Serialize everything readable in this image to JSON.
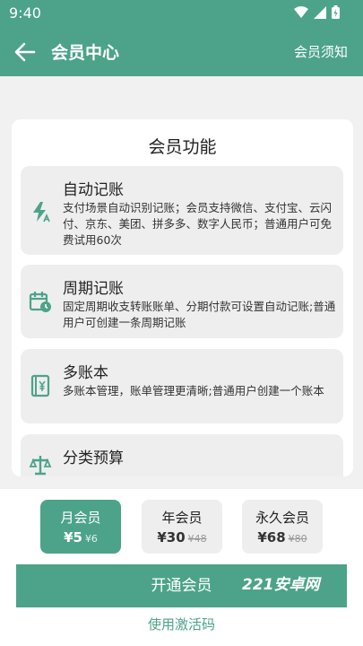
{
  "status": {
    "time": "9:40"
  },
  "appbar": {
    "title": "会员中心",
    "action": "会员须知"
  },
  "features": {
    "title": "会员功能",
    "items": [
      {
        "title": "自动记账",
        "desc": "支付场景自动识别记账；会员支持微信、支付宝、云闪付、京东、美团、拼多多、数字人民币；普通用户可免费试用60次",
        "icon": "lightning-icon"
      },
      {
        "title": "周期记账",
        "desc": "固定周期收支转账账单、分期付款可设置自动记账;普通用户可创建一条周期记账",
        "icon": "calendar-clock-icon"
      },
      {
        "title": "多账本",
        "desc": "多账本管理，账单管理更清晰;普通用户创建一个账本",
        "icon": "ledger-icon"
      },
      {
        "title": "分类预算",
        "desc": "",
        "icon": "balance-scale-icon"
      }
    ]
  },
  "plans": [
    {
      "name": "月会员",
      "price": "¥5",
      "original": "¥6",
      "selected": true
    },
    {
      "name": "年会员",
      "price": "¥30",
      "original": "¥48",
      "selected": false
    },
    {
      "name": "永久会员",
      "price": "¥68",
      "original": "¥80",
      "selected": false
    }
  ],
  "actions": {
    "open": "开通会员",
    "activate": "使用激活码"
  },
  "watermark": "221安卓网",
  "colors": {
    "primary": "#4ca38a"
  }
}
